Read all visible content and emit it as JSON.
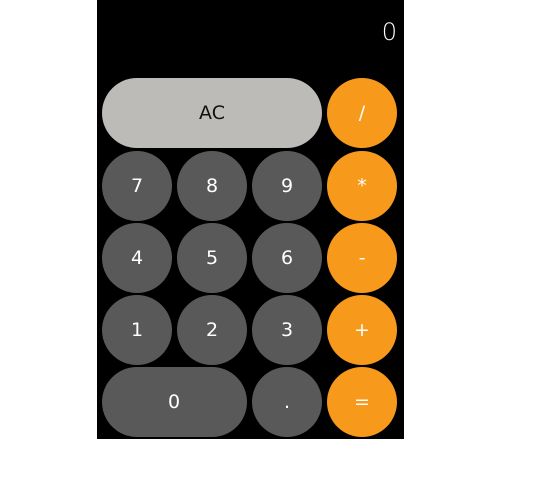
{
  "display": {
    "value": "0"
  },
  "keys": {
    "clear": "AC",
    "divide": "/",
    "multiply": "*",
    "subtract": "-",
    "add": "+",
    "equals": "=",
    "decimal": ".",
    "d0": "0",
    "d1": "1",
    "d2": "2",
    "d3": "3",
    "d4": "4",
    "d5": "5",
    "d6": "6",
    "d7": "7",
    "d8": "8",
    "d9": "9"
  },
  "colors": {
    "background": "#000000",
    "digit": "#595959",
    "function": "#bcbbb7",
    "operator": "#f7991b"
  }
}
